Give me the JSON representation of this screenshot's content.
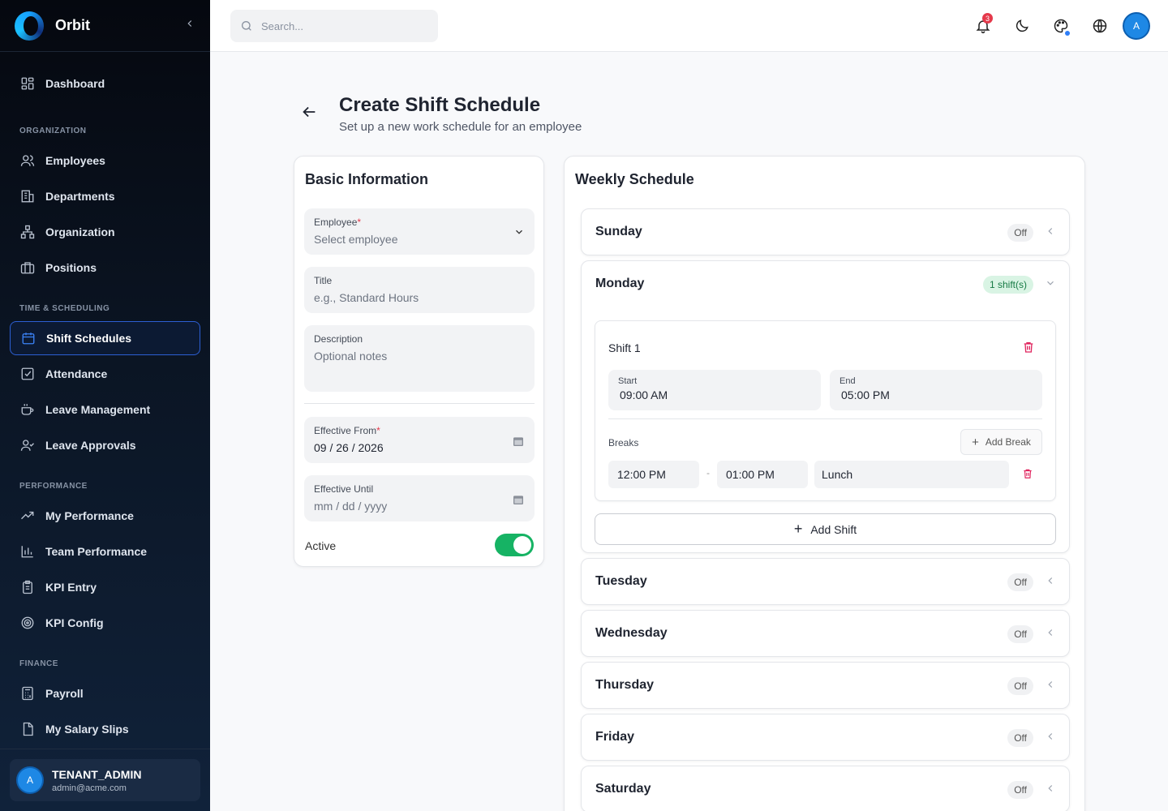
{
  "app": {
    "name": "Orbit"
  },
  "sidebar": {
    "top_item": {
      "label": "Dashboard"
    },
    "sections": [
      {
        "title": "ORGANIZATION",
        "items": [
          "Employees",
          "Departments",
          "Organization",
          "Positions"
        ]
      },
      {
        "title": "TIME & SCHEDULING",
        "items": [
          "Shift Schedules",
          "Attendance",
          "Leave Management",
          "Leave Approvals"
        ]
      },
      {
        "title": "PERFORMANCE",
        "items": [
          "My Performance",
          "Team Performance",
          "KPI Entry",
          "KPI Config"
        ]
      },
      {
        "title": "FINANCE",
        "items": [
          "Payroll",
          "My Salary Slips"
        ]
      }
    ],
    "active_item": "Shift Schedules",
    "user": {
      "avatar": "A",
      "role": "TENANT_ADMIN",
      "email": "admin@acme.com"
    }
  },
  "topbar": {
    "search_placeholder": "Search...",
    "notification_count": "3",
    "avatar": "A"
  },
  "page": {
    "title": "Create Shift Schedule",
    "subtitle": "Set up a new work schedule for an employee"
  },
  "basic_info": {
    "title": "Basic Information",
    "employee": {
      "label": "Employee",
      "placeholder": "Select employee"
    },
    "title_field": {
      "label": "Title",
      "placeholder": "e.g., Standard Hours"
    },
    "description": {
      "label": "Description",
      "placeholder": "Optional notes"
    },
    "effective_from": {
      "label": "Effective From",
      "value": "09 / 26 / 2026"
    },
    "effective_until": {
      "label": "Effective Until",
      "placeholder": "mm / dd / yyyy"
    },
    "active": {
      "label": "Active",
      "on": true
    }
  },
  "weekly": {
    "title": "Weekly Schedule",
    "off_label": "Off",
    "days": {
      "sunday": "Sunday",
      "monday": "Monday",
      "tuesday": "Tuesday",
      "wednesday": "Wednesday",
      "thursday": "Thursday",
      "friday": "Friday",
      "saturday": "Saturday"
    },
    "monday_detail": {
      "shift_count": "1 shift(s)",
      "shift": {
        "title": "Shift 1",
        "start_label": "Start",
        "start": "09:00 AM",
        "end_label": "End",
        "end": "05:00 PM",
        "breaks_label": "Breaks",
        "add_break": "Add Break",
        "break": {
          "start": "12:00 PM",
          "separator": "-",
          "end": "01:00 PM",
          "name": "Lunch"
        }
      },
      "add_shift": "Add Shift"
    }
  },
  "colors": {
    "accent": "#2f7ef7",
    "toggle_on": "#16b364",
    "danger": "#e0245e",
    "sidebar_bg": "#0b1524"
  }
}
